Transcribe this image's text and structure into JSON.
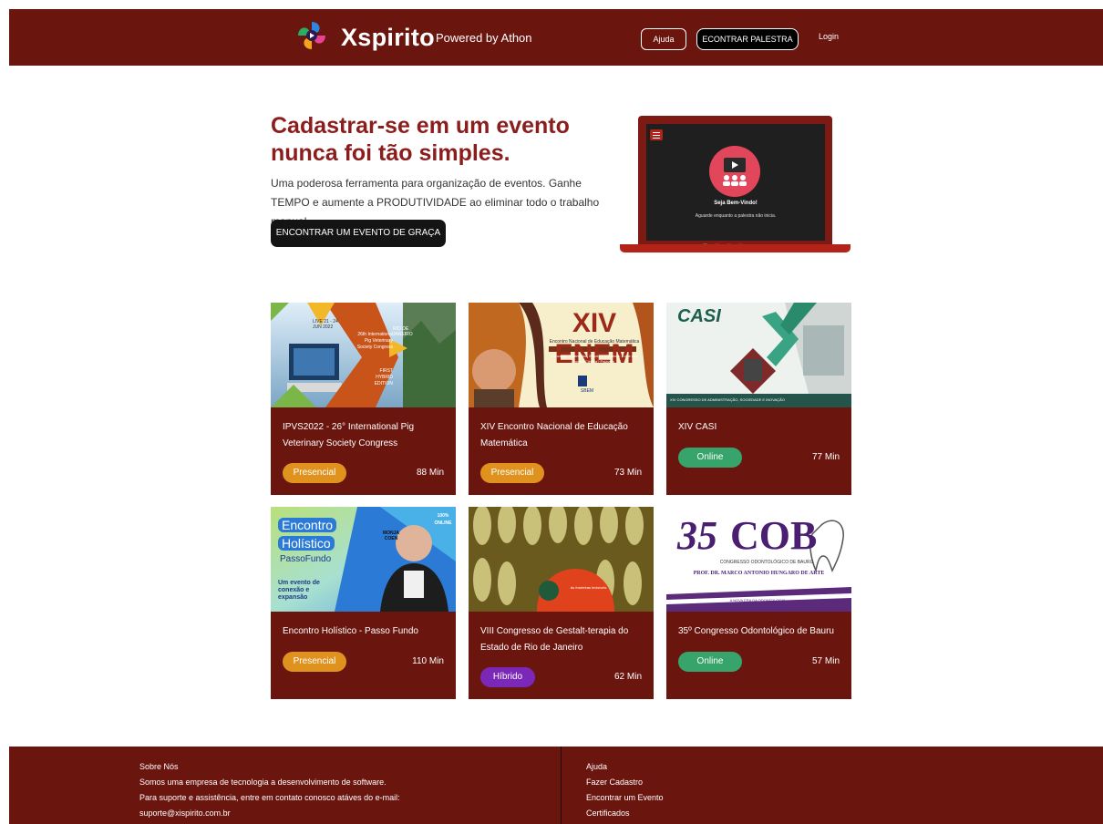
{
  "header": {
    "brand": "Xspirito",
    "powered_by": "Powered by Athon",
    "help_label": "Ajuda",
    "find_talk_label": "ECONTRAR PALESTRA",
    "login_label": "Login",
    "brand_color": "#6b150f"
  },
  "hero": {
    "title": "Cadastrar-se em um evento nunca foi tão simples.",
    "description": "Uma poderosa ferramenta para organização de eventos. Ganhe TEMPO e aumente a PRODUTIVIDADE ao eliminar todo o trabalho manual.",
    "cta_label": "ENCONTRAR UM EVENTO DE GRAÇA",
    "laptop": {
      "welcome": "Seja Bem-Vindo!",
      "wait": "Aguarde enquanto a palestra não inicia."
    }
  },
  "events": [
    {
      "title": "IPVS2022 - 26° International Pig Veterinary Society Congress",
      "mode": "Presencial",
      "duration": "88 Min",
      "image": {
        "dates": "LIVE 21 - 24 JUN 2022",
        "city": "RIO DE JANEIRO",
        "headline": "26th International Pig Veterinary Society Congress",
        "edition": "FIRST HYBRID EDITION"
      }
    },
    {
      "title": "XIV Encontro Nacional de Educação Matemática",
      "mode": "Presencial",
      "duration": "73 Min",
      "image": {
        "headline": "XIV ENEM",
        "sub": "Encontro Nacional de Educação Matemática",
        "theme": "Educação Matemática, Escola e Docência: o que nos toca à Ciência? Palavras",
        "org": "SBEM"
      }
    },
    {
      "title": "XIV CASI",
      "mode": "Online",
      "duration": "77 Min",
      "image": {
        "headline": "CASI",
        "caption": "XIV CONGRESSO DE ADMINISTRAÇÃO, SOCIEDADE E INOVAÇÃO"
      }
    },
    {
      "title": "Encontro Holístico - Passo Fundo",
      "mode": "Presencial",
      "duration": "110 Min",
      "image": {
        "line1": "Encontro",
        "line2": "Holístico",
        "line3": "PassoFundo",
        "tagline": "Um evento de conexão e expansão",
        "badge": "100% ONLINE",
        "guest": "MONJA COEN"
      }
    },
    {
      "title": "VIII Congresso de Gestalt-terapia do Estado de Rio de Janeiro",
      "mode": "Híbrido",
      "duration": "62 Min",
      "image": {
        "caption": "As fronteiras invisíveis"
      }
    },
    {
      "title": "35º Congresso Odontológico de Bauru",
      "mode": "Online",
      "duration": "57 Min",
      "image": {
        "number": "35",
        "acronym": "COB",
        "sub": "CONGRESSO ODONTOLÓGICO DE BAURU",
        "honoree": "PROF. DR. MARCO ANTONIO HUNGARO DE ARTE",
        "tagline": "A NOVA ERA DA ODONTOLOGIA"
      }
    }
  ],
  "mode_colors": {
    "Presencial": "#e0921e",
    "Online": "#37a56b",
    "Híbrido": "#7b27b8"
  },
  "footer": {
    "about_title": "Sobre Nós",
    "about_line1": "Somos uma empresa de tecnologia a desenvolvimento de software.",
    "about_line2": "Para suporte e assistência, entre em contato conosco atáves do e-mail:",
    "about_email": "suporte@xispirito.com.br",
    "links": [
      "Ajuda",
      "Fazer Cadastro",
      "Encontrar um Evento",
      "Certificados"
    ]
  }
}
